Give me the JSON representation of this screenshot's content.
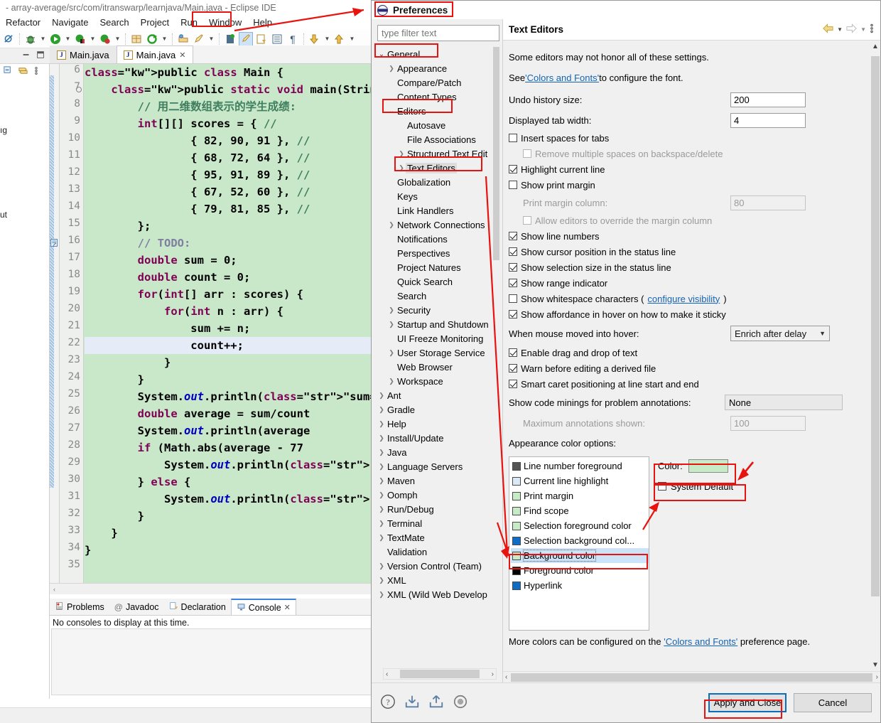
{
  "window": {
    "title": "- array-average/src/com/itranswarp/learnjava/Main.java - Eclipse IDE",
    "minimize": "—",
    "maximize": "▢",
    "close": "✕"
  },
  "menubar": {
    "items": [
      "Refactor",
      "Navigate",
      "Search",
      "Project",
      "Run",
      "Window",
      "Help"
    ],
    "highlighted": "Window"
  },
  "left_view": {
    "fragments": [
      "ıg",
      "ut"
    ]
  },
  "editor": {
    "tabs": [
      {
        "label": "Main.java",
        "icon": "java-file-icon",
        "active": false,
        "closable": false
      },
      {
        "label": "Main.java",
        "icon": "java-file-icon",
        "active": true,
        "closable": true,
        "close": "✕"
      }
    ],
    "first_line_number": 6,
    "highlighted_line": 22,
    "lines": [
      {
        "n": 6,
        "text": "public class Main {"
      },
      {
        "n": 7,
        "text": "    public static void main(String",
        "fold": true
      },
      {
        "n": 8,
        "text": "        // 用二维数组表示的学生成绩:"
      },
      {
        "n": 9,
        "text": "        int[][] scores = { //"
      },
      {
        "n": 10,
        "text": "                { 82, 90, 91 }, //"
      },
      {
        "n": 11,
        "text": "                { 68, 72, 64 }, //"
      },
      {
        "n": 12,
        "text": "                { 95, 91, 89 }, //"
      },
      {
        "n": 13,
        "text": "                { 67, 52, 60 }, //"
      },
      {
        "n": 14,
        "text": "                { 79, 81, 85 }, //"
      },
      {
        "n": 15,
        "text": "        };"
      },
      {
        "n": 16,
        "text": "        // TODO:"
      },
      {
        "n": 17,
        "text": "        double sum = 0;"
      },
      {
        "n": 18,
        "text": "        double count = 0;"
      },
      {
        "n": 19,
        "text": "        for(int[] arr : scores) {"
      },
      {
        "n": 20,
        "text": "            for(int n : arr) {"
      },
      {
        "n": 21,
        "text": "                sum += n;"
      },
      {
        "n": 22,
        "text": "                count++;"
      },
      {
        "n": 23,
        "text": "            }"
      },
      {
        "n": 24,
        "text": "        }"
      },
      {
        "n": 25,
        "text": "        System.out.println(\"sum=\""
      },
      {
        "n": 26,
        "text": "        double average = sum/count"
      },
      {
        "n": 27,
        "text": "        System.out.println(average"
      },
      {
        "n": 28,
        "text": "        if (Math.abs(average - 77"
      },
      {
        "n": 29,
        "text": "            System.out.println(\"测"
      },
      {
        "n": 30,
        "text": "        } else {"
      },
      {
        "n": 31,
        "text": "            System.out.println(\"测"
      },
      {
        "n": 32,
        "text": "        }"
      },
      {
        "n": 33,
        "text": "    }"
      },
      {
        "n": 34,
        "text": "}"
      },
      {
        "n": 35,
        "text": ""
      }
    ]
  },
  "bottom_view": {
    "tabs": [
      {
        "label": "Problems",
        "icon": "problems-icon",
        "active": false
      },
      {
        "label": "Javadoc",
        "icon": "javadoc-icon",
        "active": false
      },
      {
        "label": "Declaration",
        "icon": "declaration-icon",
        "active": false
      },
      {
        "label": "Console",
        "icon": "console-icon",
        "active": true,
        "close": "✕"
      }
    ],
    "message": "No consoles to display at this time."
  },
  "preferences": {
    "title": "Preferences",
    "filter_placeholder": "type filter text",
    "tree": [
      {
        "label": "General",
        "indent": 0,
        "twisty": "open"
      },
      {
        "label": "Appearance",
        "indent": 1,
        "twisty": "closed"
      },
      {
        "label": "Compare/Patch",
        "indent": 1,
        "twisty": "none"
      },
      {
        "label": "Content Types",
        "indent": 1,
        "twisty": "none"
      },
      {
        "label": "Editors",
        "indent": 1,
        "twisty": "open"
      },
      {
        "label": "Autosave",
        "indent": 2,
        "twisty": "none"
      },
      {
        "label": "File Associations",
        "indent": 2,
        "twisty": "none"
      },
      {
        "label": "Structured Text Edit",
        "indent": 2,
        "twisty": "closed"
      },
      {
        "label": "Text Editors",
        "indent": 2,
        "twisty": "closed",
        "selected": true
      },
      {
        "label": "Globalization",
        "indent": 1,
        "twisty": "none"
      },
      {
        "label": "Keys",
        "indent": 1,
        "twisty": "none"
      },
      {
        "label": "Link Handlers",
        "indent": 1,
        "twisty": "none"
      },
      {
        "label": "Network Connections",
        "indent": 1,
        "twisty": "closed"
      },
      {
        "label": "Notifications",
        "indent": 1,
        "twisty": "none"
      },
      {
        "label": "Perspectives",
        "indent": 1,
        "twisty": "none"
      },
      {
        "label": "Project Natures",
        "indent": 1,
        "twisty": "none"
      },
      {
        "label": "Quick Search",
        "indent": 1,
        "twisty": "none"
      },
      {
        "label": "Search",
        "indent": 1,
        "twisty": "none"
      },
      {
        "label": "Security",
        "indent": 1,
        "twisty": "closed"
      },
      {
        "label": "Startup and Shutdown",
        "indent": 1,
        "twisty": "closed"
      },
      {
        "label": "UI Freeze Monitoring",
        "indent": 1,
        "twisty": "none"
      },
      {
        "label": "User Storage Service",
        "indent": 1,
        "twisty": "closed"
      },
      {
        "label": "Web Browser",
        "indent": 1,
        "twisty": "none"
      },
      {
        "label": "Workspace",
        "indent": 1,
        "twisty": "closed"
      },
      {
        "label": "Ant",
        "indent": 0,
        "twisty": "closed"
      },
      {
        "label": "Gradle",
        "indent": 0,
        "twisty": "closed"
      },
      {
        "label": "Help",
        "indent": 0,
        "twisty": "closed"
      },
      {
        "label": "Install/Update",
        "indent": 0,
        "twisty": "closed"
      },
      {
        "label": "Java",
        "indent": 0,
        "twisty": "closed"
      },
      {
        "label": "Language Servers",
        "indent": 0,
        "twisty": "closed"
      },
      {
        "label": "Maven",
        "indent": 0,
        "twisty": "closed"
      },
      {
        "label": "Oomph",
        "indent": 0,
        "twisty": "closed"
      },
      {
        "label": "Run/Debug",
        "indent": 0,
        "twisty": "closed"
      },
      {
        "label": "Terminal",
        "indent": 0,
        "twisty": "closed"
      },
      {
        "label": "TextMate",
        "indent": 0,
        "twisty": "closed"
      },
      {
        "label": "Validation",
        "indent": 0,
        "twisty": "none"
      },
      {
        "label": "Version Control (Team)",
        "indent": 0,
        "twisty": "closed"
      },
      {
        "label": "XML",
        "indent": 0,
        "twisty": "closed"
      },
      {
        "label": "XML (Wild Web Develop",
        "indent": 0,
        "twisty": "closed"
      }
    ],
    "page": {
      "title": "Text Editors",
      "note1": "Some editors may not honor all of these settings.",
      "note2_pre": "See ",
      "note2_link": "'Colors and Fonts'",
      "note2_post": " to configure the font.",
      "undo_label": "Undo history size:",
      "undo_value": "200",
      "tabwidth_label": "Displayed tab width:",
      "tabwidth_value": "4",
      "checkboxes": [
        {
          "label": "Insert spaces for tabs",
          "checked": false,
          "indent": 0,
          "disabled": false
        },
        {
          "label": "Remove multiple spaces on backspace/delete",
          "checked": false,
          "indent": 1,
          "disabled": true
        },
        {
          "label": "Highlight current line",
          "checked": true,
          "indent": 0,
          "disabled": false
        },
        {
          "label": "Show print margin",
          "checked": false,
          "indent": 0,
          "disabled": false
        }
      ],
      "print_margin_label": "Print margin column:",
      "print_margin_value": "80",
      "allow_override_label": "Allow editors to override the margin column",
      "checkboxes2": [
        {
          "label": "Show line numbers",
          "checked": true
        },
        {
          "label": "Show cursor position in the status line",
          "checked": true
        },
        {
          "label": "Show selection size in the status line",
          "checked": true
        },
        {
          "label": "Show range indicator",
          "checked": true
        }
      ],
      "whitespace_label": "Show whitespace characters (",
      "whitespace_link": "configure visibility",
      "whitespace_label_end": ")",
      "affordance_label": "Show affordance in hover on how to make it sticky",
      "hover_label": "When mouse moved into hover:",
      "hover_value": "Enrich after delay",
      "checkboxes3": [
        {
          "label": "Enable drag and drop of text",
          "checked": true
        },
        {
          "label": "Warn before editing a derived file",
          "checked": true
        },
        {
          "label": "Smart caret positioning at line start and end",
          "checked": true
        }
      ],
      "code_minings_label": "Show code minings for problem annotations:",
      "code_minings_value": "None",
      "max_annotations_label": "Maximum annotations shown:",
      "max_annotations_value": "100",
      "appearance_label": "Appearance color options:",
      "color_items": [
        {
          "label": "Line number foreground",
          "swatch": "#545454"
        },
        {
          "label": "Current line highlight",
          "swatch": "#dbe8f7"
        },
        {
          "label": "Print margin",
          "swatch": "#c7ebc7"
        },
        {
          "label": "Find scope",
          "swatch": "#c7ebc7"
        },
        {
          "label": "Selection foreground color",
          "swatch": "#c7ebc7"
        },
        {
          "label": "Selection background col...",
          "swatch": "#0f6ec4"
        },
        {
          "label": "Background color",
          "swatch": "#c7ebc7",
          "selected": true
        },
        {
          "label": "Foreground color",
          "swatch": "#000000"
        },
        {
          "label": "Hyperlink",
          "swatch": "#0f6ec4"
        }
      ],
      "color_label": "Color:",
      "color_value": "#c7ebc7",
      "system_default_label": "System Default",
      "system_default_checked": false,
      "more_colors_pre": "More colors can be configured on the ",
      "more_colors_link": "'Colors and Fonts'",
      "more_colors_post": " preference page."
    },
    "footer": {
      "icons": [
        "help-icon",
        "import-icon",
        "export-icon",
        "restore-defaults-icon"
      ],
      "apply_label": "Apply and Close",
      "cancel_label": "Cancel"
    }
  },
  "annotations": {
    "color": "#e8130e",
    "boxes": [
      "window-menu",
      "preferences-title",
      "general-node",
      "editors-node",
      "text-editors-node",
      "background-color-item",
      "color-swatch-row",
      "system-default-row",
      "apply-and-close-button"
    ]
  }
}
